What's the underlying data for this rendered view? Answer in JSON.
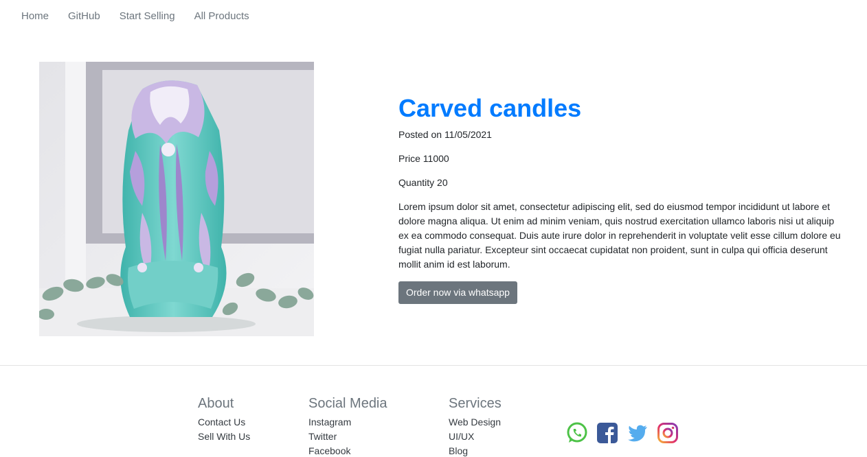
{
  "nav": {
    "items": [
      "Home",
      "GitHub",
      "Start Selling",
      "All Products"
    ]
  },
  "product": {
    "title": "Carved candles",
    "posted": "Posted on 11/05/2021",
    "price": "Price 11000",
    "quantity": "Quantity 20",
    "description": "Lorem ipsum dolor sit amet, consectetur adipiscing elit, sed do eiusmod tempor incididunt ut labore et dolore magna aliqua. Ut enim ad minim veniam, quis nostrud exercitation ullamco laboris nisi ut aliquip ex ea commodo consequat. Duis aute irure dolor in reprehenderit in voluptate velit esse cillum dolore eu fugiat nulla pariatur. Excepteur sint occaecat cupidatat non proident, sunt in culpa qui officia deserunt mollit anim id est laborum.",
    "order_label": "Order now via whatsapp"
  },
  "footer": {
    "about": {
      "heading": "About",
      "links": [
        "Contact Us",
        "Sell With Us"
      ]
    },
    "social": {
      "heading": "Social Media",
      "links": [
        "Instagram",
        "Twitter",
        "Facebook"
      ]
    },
    "services": {
      "heading": "Services",
      "links": [
        "Web Design",
        "UI/UX",
        "Blog"
      ]
    },
    "icons": [
      "whatsapp-icon",
      "facebook-icon",
      "twitter-icon",
      "instagram-icon"
    ]
  },
  "colors": {
    "title_blue": "#007bff",
    "button_gray": "#6c757d",
    "whatsapp": "#4dc247",
    "facebook": "#3b5998",
    "twitter": "#55acee",
    "candle_teal": "#5fc7c0",
    "candle_lilac": "#b9a4d8"
  }
}
